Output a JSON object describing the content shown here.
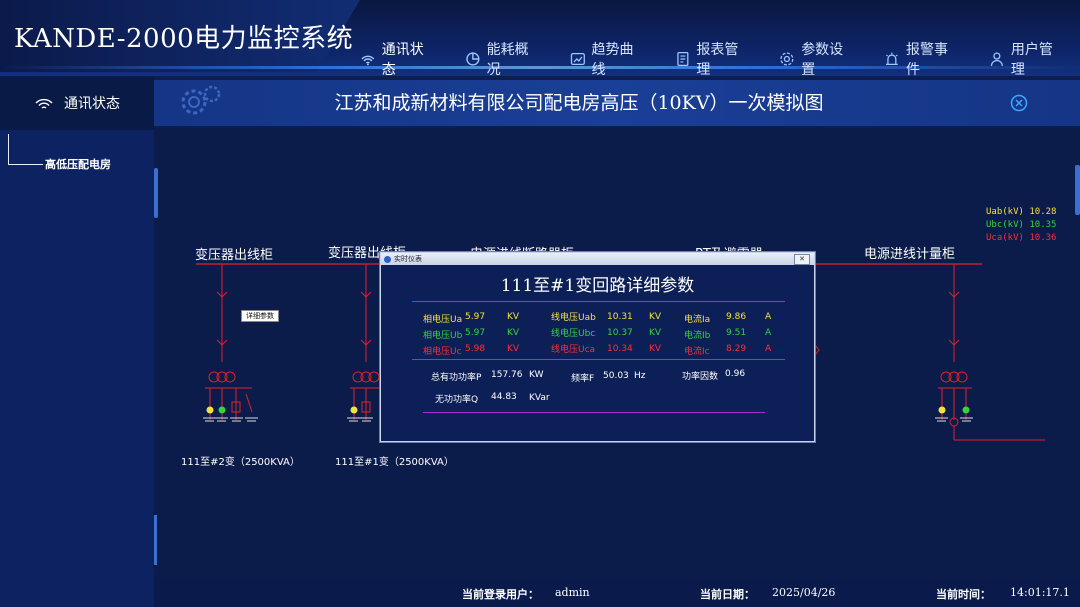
{
  "app": {
    "title": "KANDE-2000电力监控系统"
  },
  "nav": [
    {
      "label": "通讯状态",
      "icon": "wifi-icon"
    },
    {
      "label": "能耗概况",
      "icon": "pie-chart-icon"
    },
    {
      "label": "趋势曲线",
      "icon": "trend-icon"
    },
    {
      "label": "报表管理",
      "icon": "report-icon"
    },
    {
      "label": "参数设置",
      "icon": "gear-icon"
    },
    {
      "label": "报警事件",
      "icon": "alarm-icon"
    },
    {
      "label": "用户管理",
      "icon": "user-icon"
    }
  ],
  "sidebar": {
    "header": "通讯状态",
    "items": [
      {
        "label": "高低压配电房"
      }
    ]
  },
  "page": {
    "title": "江苏和成新材料有限公司配电房高压（10KV）一次模拟图"
  },
  "diagram": {
    "cabinets": [
      "变压器出线柜",
      "变压器出线柜",
      "电源进线断路器柜",
      "PT及避雷器",
      "电源进线计量柜"
    ],
    "feeders": [
      "111至#2变（2500KVA）",
      "111至#1变（2500KVA）"
    ],
    "detail_button": "详细参数",
    "readouts": [
      {
        "label": "Uab(kV)",
        "value": "10.28",
        "color": "#f4e23a"
      },
      {
        "label": "Ubc(kV)",
        "value": "10.35",
        "color": "#35d43b"
      },
      {
        "label": "Uca(kV)",
        "value": "10.36",
        "color": "#ff3030"
      }
    ]
  },
  "dialog": {
    "window_title": "实时仪表",
    "close_label": "✕",
    "title": "111至#1变回路详细参数",
    "rows": [
      {
        "pv_label": "相电压Ua",
        "pv": "5.97",
        "pv_unit": "KV",
        "lv_label": "线电压Uab",
        "lv": "10.31",
        "lv_unit": "KV",
        "i_label": "电流Ia",
        "i": "9.86",
        "i_unit": "A"
      },
      {
        "pv_label": "相电压Ub",
        "pv": "5.97",
        "pv_unit": "KV",
        "lv_label": "线电压Ubc",
        "lv": "10.37",
        "lv_unit": "KV",
        "i_label": "电流Ib",
        "i": "9.51",
        "i_unit": "A"
      },
      {
        "pv_label": "相电压Uc",
        "pv": "5.98",
        "pv_unit": "KV",
        "lv_label": "线电压Uca",
        "lv": "10.34",
        "lv_unit": "KV",
        "i_label": "电流Ic",
        "i": "8.29",
        "i_unit": "A"
      }
    ],
    "power": {
      "p_label": "总有功功率P",
      "p": "157.76",
      "p_unit": "KW",
      "f_label": "频率F",
      "f": "50.03",
      "f_unit": "Hz",
      "pf_label": "功率因数",
      "pf": "0.96",
      "q_label": "无功功率Q",
      "q": "44.83",
      "q_unit": "KVar"
    }
  },
  "footer": {
    "user_label": "当前登录用户：",
    "user": "admin",
    "date_label": "当前日期：",
    "date": "2025/04/26",
    "time_label": "当前时间：",
    "time": "14:01:17.1"
  },
  "colors": {
    "background": "#0c1d4f",
    "bus": "#e0202a",
    "phase_a": "#f4e23a",
    "phase_b": "#35d43b",
    "phase_c": "#ff3030",
    "divider": "#a32bd0"
  }
}
